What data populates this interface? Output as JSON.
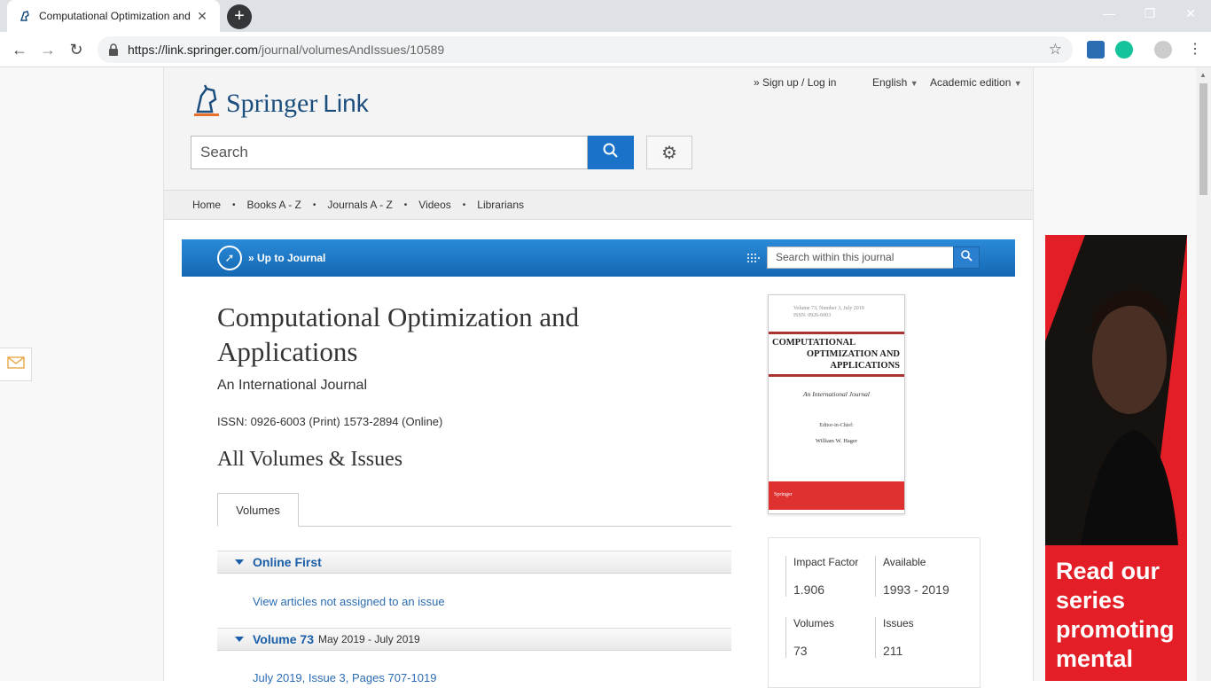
{
  "browser": {
    "tab_title": "Computational Optimization and Applications | springerlink",
    "url_host": "https://link.springer.com",
    "url_path": "/journal/volumesAndIssues/10589"
  },
  "header": {
    "logo_springer": "Springer",
    "logo_link": "Link",
    "signup": "» Sign up / Log in",
    "language": "English",
    "edition": "Academic edition",
    "search_placeholder": "Search"
  },
  "subnav": {
    "items": [
      "Home",
      "Books A - Z",
      "Journals A - Z",
      "Videos",
      "Librarians"
    ]
  },
  "journal_bar": {
    "up_label": "» Up to Journal",
    "search_placeholder": "Search within this journal"
  },
  "journal": {
    "title": "Computational Optimization and Applications",
    "subtitle": "An International Journal",
    "issn": "ISSN: 0926-6003 (Print) 1573-2894 (Online)",
    "section_heading": "All Volumes & Issues"
  },
  "tabs": {
    "volumes": "Volumes"
  },
  "accordion": {
    "online_first": "Online First",
    "online_first_link": "View articles not assigned to an issue",
    "volume73_label": "Volume 73",
    "volume73_dates": "May 2019 - July 2019",
    "volume73_link": "July 2019, Issue 3, Pages 707-1019"
  },
  "cover": {
    "vol_line1": "Volume 73, Number 3, July 2019",
    "vol_line2": "ISSN: 0926-6003",
    "title_l1": "COMPUTATIONAL",
    "title_l2": "OPTIMIZATION AND",
    "title_l3": "APPLICATIONS",
    "intl": "An International Journal",
    "eic": "Editor-in-Chief:",
    "editor": "William W. Hager",
    "publisher": "Springer"
  },
  "stats": {
    "impact_label": "Impact Factor",
    "impact_value": "1.906",
    "available_label": "Available",
    "available_value": "1993 - 2019",
    "volumes_label": "Volumes",
    "volumes_value": "73",
    "issues_label": "Issues",
    "issues_value": "211"
  },
  "ad": {
    "text": "Read our series promoting mental"
  },
  "colors": {
    "accent_blue": "#1a73c8",
    "link_blue": "#2c6cb3",
    "ad_red": "#e41e26"
  }
}
